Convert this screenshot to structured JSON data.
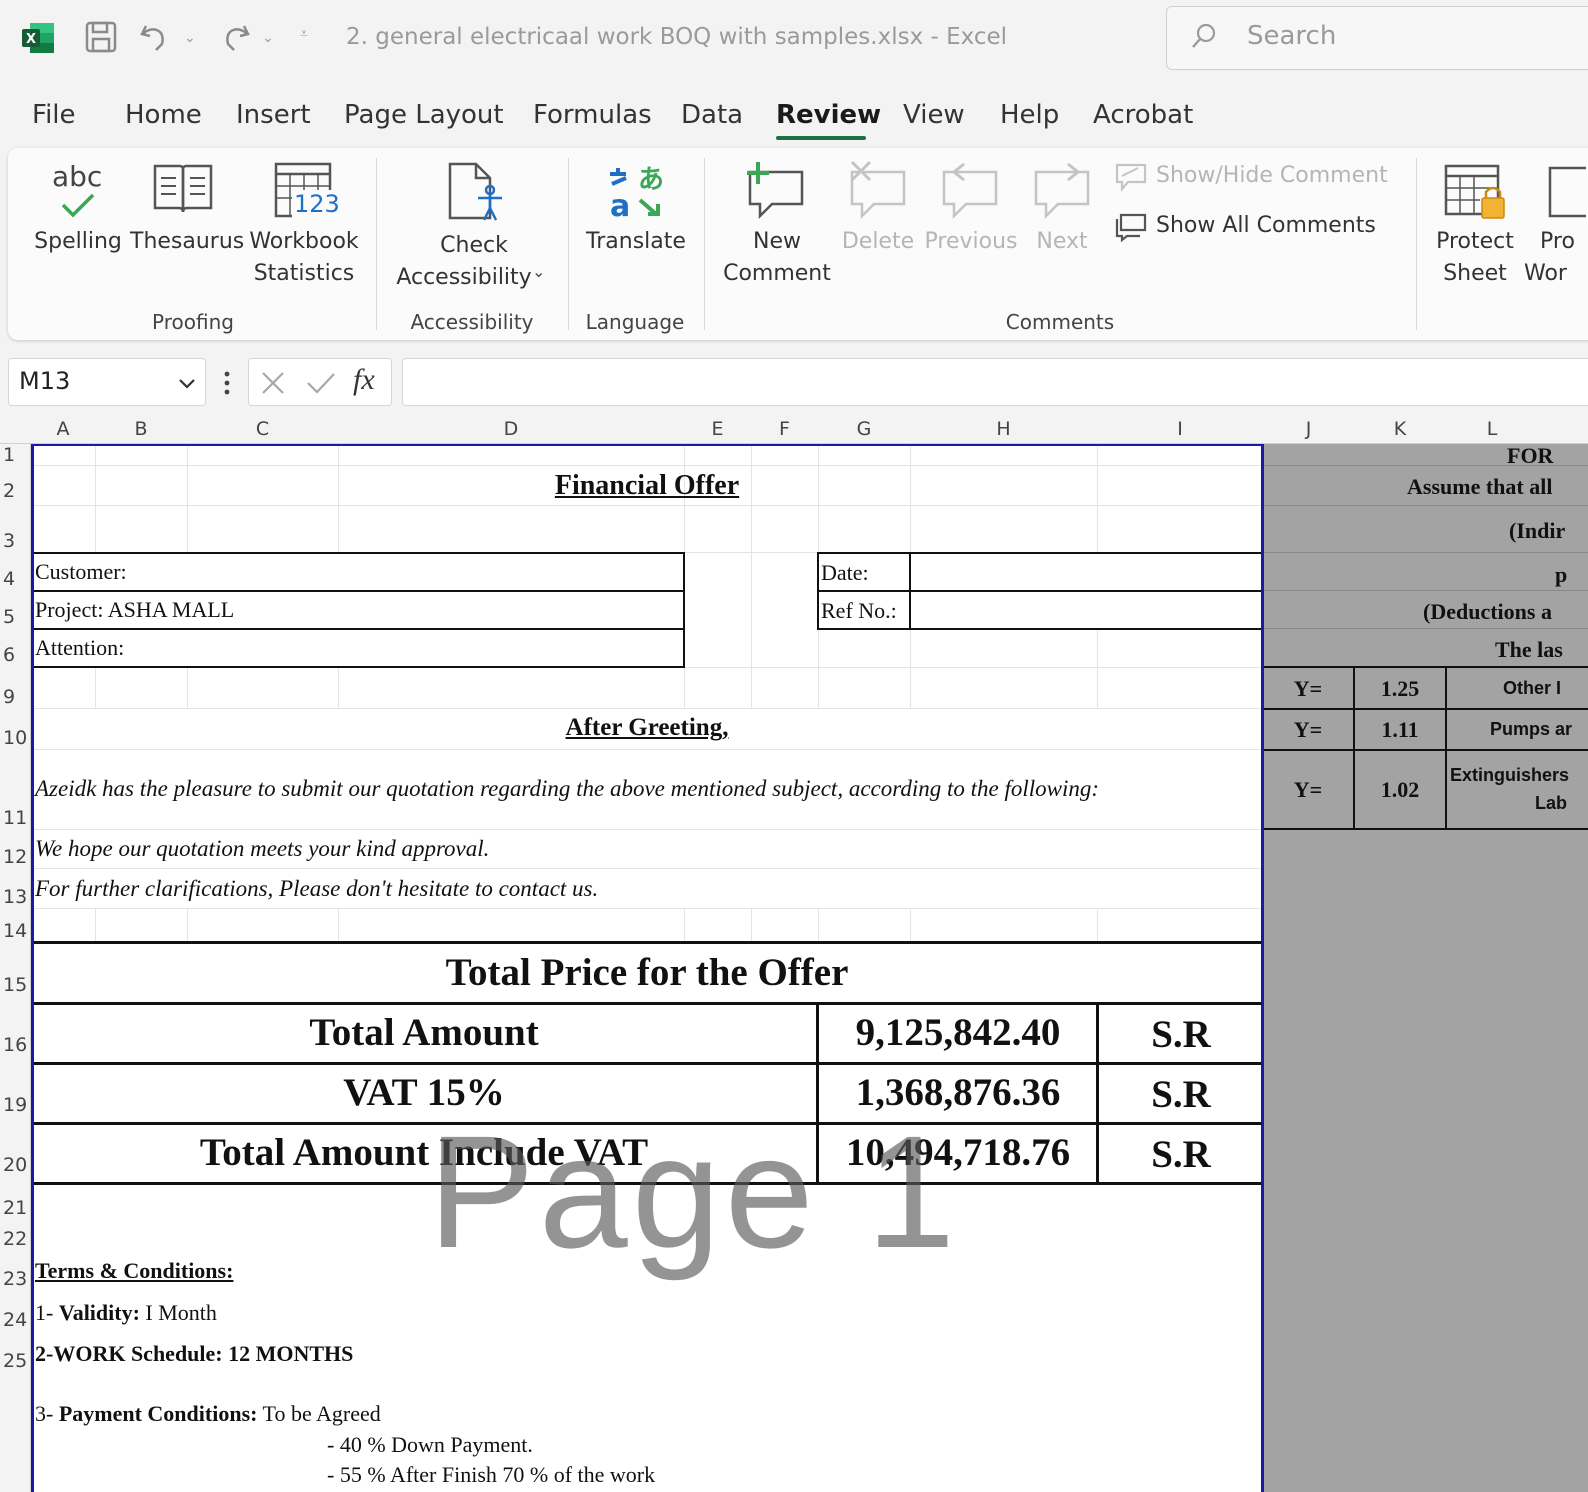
{
  "titlebar": {
    "doc_title": "2. general electricaal work BOQ with samples.xlsx  -  Excel",
    "search_placeholder": "Search"
  },
  "menu": {
    "file": "File",
    "home": "Home",
    "insert": "Insert",
    "page_layout": "Page Layout",
    "formulas": "Formulas",
    "data": "Data",
    "review": "Review",
    "view": "View",
    "help": "Help",
    "acrobat": "Acrobat",
    "active": "Review"
  },
  "ribbon": {
    "spelling": "Spelling",
    "spelling_icon_text": "abc",
    "thesaurus": "Thesaurus",
    "workbook_line1": "Workbook",
    "workbook_line2": "Statistics",
    "workbook_icon_text": "123",
    "check_line1": "Check",
    "check_line2": "Accessibility",
    "translate": "Translate",
    "new_line1": "New",
    "new_line2": "Comment",
    "delete": "Delete",
    "previous": "Previous",
    "next": "Next",
    "show_hide": "Show/Hide Comment",
    "show_all": "Show All Comments",
    "protect_line1": "Protect",
    "protect_line2": "Sheet",
    "protect_wb_line1": "Pro",
    "protect_wb_line2": "Wor",
    "groups": {
      "proofing": "Proofing",
      "accessibility": "Accessibility",
      "language": "Language",
      "comments": "Comments"
    }
  },
  "formula_bar": {
    "name_box": "M13",
    "fx": "fx",
    "content": ""
  },
  "columns": [
    "A",
    "B",
    "C",
    "D",
    "E",
    "F",
    "G",
    "H",
    "I",
    "J",
    "K",
    "L"
  ],
  "rows": [
    "1",
    "2",
    "3",
    "4",
    "5",
    "6",
    "9",
    "10",
    "11",
    "12",
    "13",
    "14",
    "15",
    "16",
    "19",
    "20",
    "21",
    "22",
    "23",
    "24",
    "25"
  ],
  "sheet": {
    "title": "Financial Offer",
    "customer": "Customer:",
    "project": "Project: ASHA MALL",
    "attention": "Attention:",
    "date": "Date:",
    "ref_no": "Ref No.:",
    "greeting": "After Greeting,",
    "intro": "Azeidk has the pleasure to submit our quotation regarding the above mentioned subject, according to the following:",
    "hope": "We hope our quotation meets your kind approval.",
    "further": "For further clarifications, Please don't hesitate to contact us.",
    "total_header": "Total Price for the Offer",
    "total_amount_label": "Total Amount",
    "total_amount_value": "9,125,842.40",
    "total_amount_cur": "S.R",
    "vat_label": "VAT 15%",
    "vat_value": "1,368,876.36",
    "vat_cur": "S.R",
    "incl_label": "Total Amount Include VAT",
    "incl_value": "10,494,718.76",
    "incl_cur": "S.R",
    "terms_title": "Terms & Conditions:",
    "validity_prefix": "1- ",
    "validity_label": "Validity:",
    "validity_value": " I Month",
    "schedule": "2-WORK Schedule: 12 MONTHS",
    "payment_prefix": "3- ",
    "payment_label": "Payment Conditions:",
    "payment_value": "  To be Agreed",
    "payment_line1": "- 40 % Down Payment.",
    "payment_line2": "- 55 % After Finish 70 % of the work"
  },
  "side_panel": {
    "r1": "FOR",
    "r2": "Assume that all",
    "r3": "(Indir",
    "r4": "p",
    "r5": "(Deductions a",
    "r6": "The las",
    "y1_label": "Y=",
    "y1_value": "1.25",
    "y1_desc": "Other I",
    "y2_label": "Y=",
    "y2_value": "1.11",
    "y2_desc": "Pumps ar",
    "y3_label": "Y=",
    "y3_value": "1.02",
    "y3_desc_line1": "Extinguishers",
    "y3_desc_line2": "Lab"
  },
  "watermark": "Page 1",
  "colors": {
    "excel_green": "#1e7145",
    "print_border": "#1a1aa6",
    "off_page": "#a3a3a3"
  }
}
